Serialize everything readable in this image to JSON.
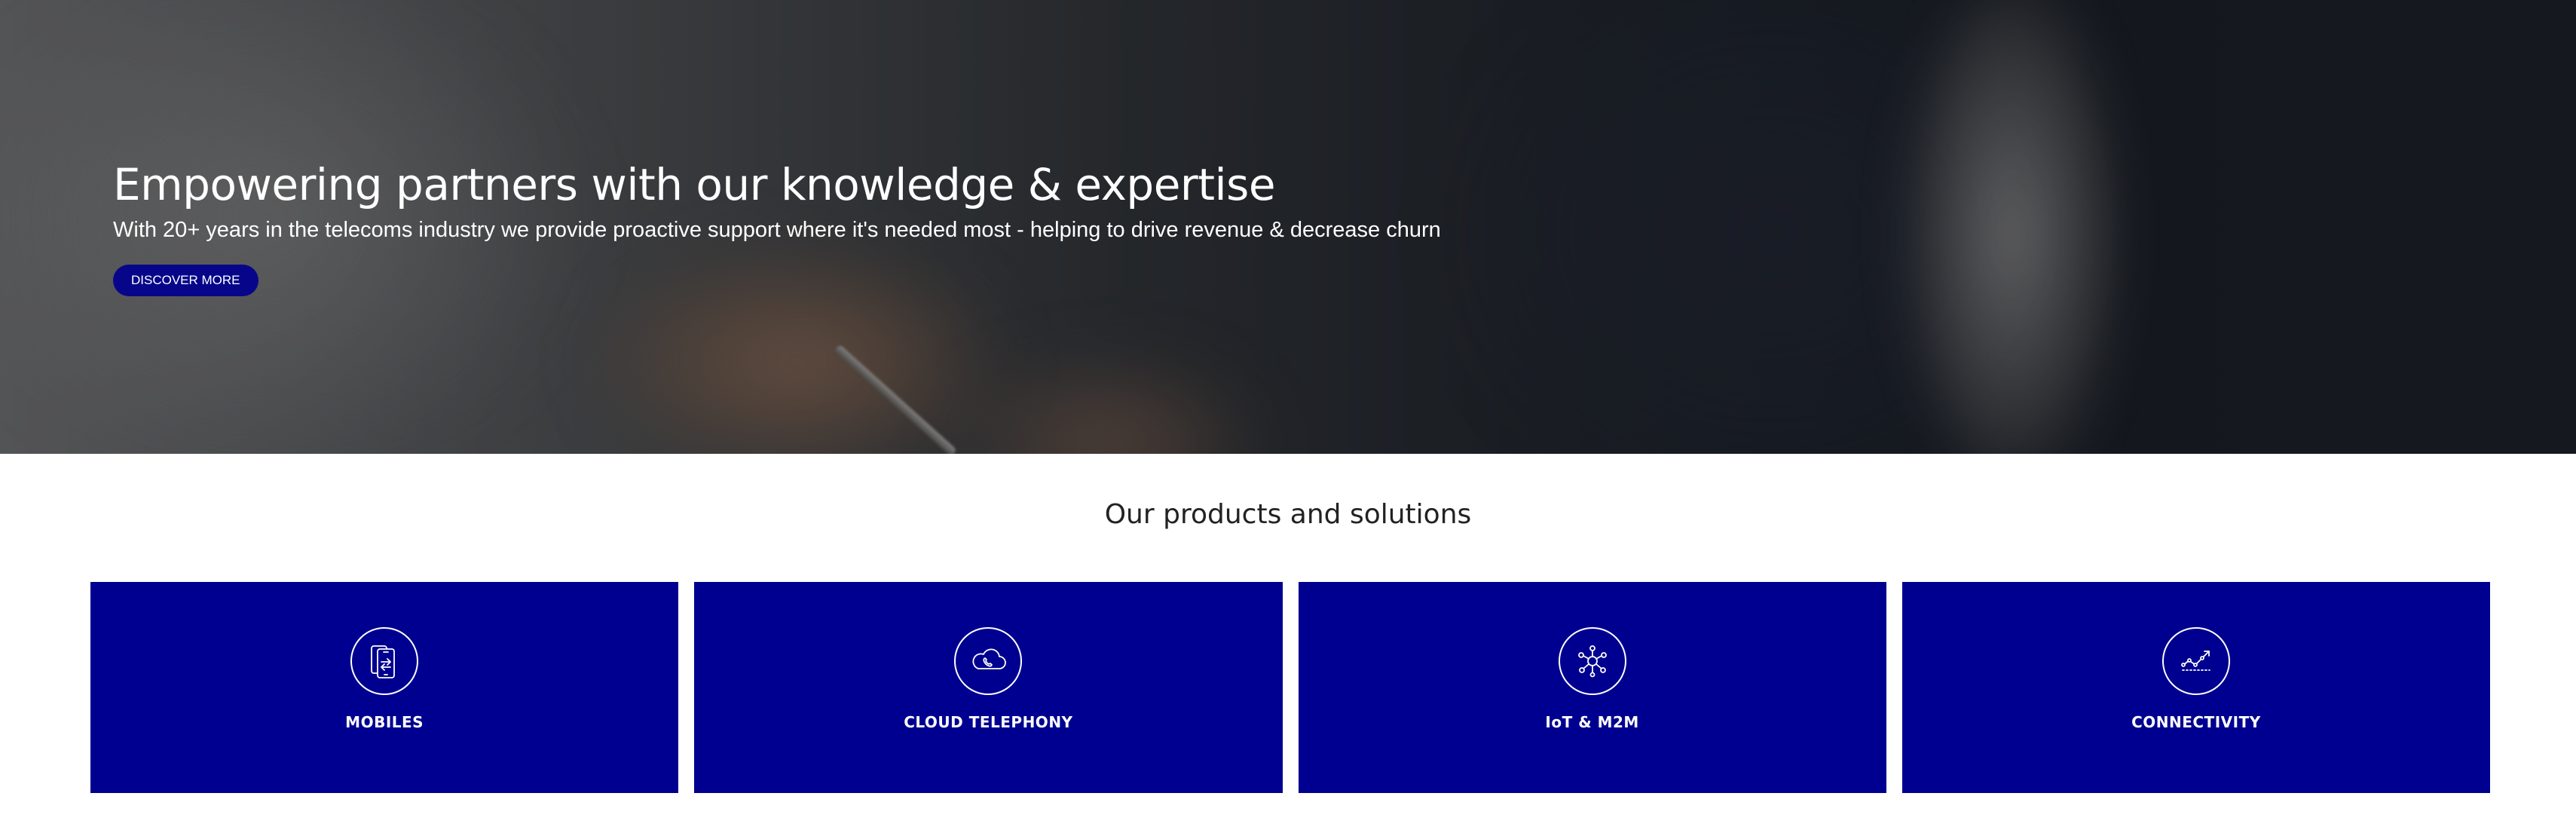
{
  "hero": {
    "title": "Empowering partners with our knowledge & expertise",
    "subtitle": "With 20+ years in the telecoms industry we provide proactive support where it's needed most - helping to drive revenue & decrease churn",
    "button_label": "DISCOVER MORE",
    "button_color": "#07068a"
  },
  "products": {
    "heading": "Our products and solutions",
    "card_color": "#000090",
    "items": [
      {
        "label": "MOBILES",
        "icon": "mobile-transfer-icon"
      },
      {
        "label": "CLOUD TELEPHONY",
        "icon": "cloud-phone-icon"
      },
      {
        "label": "IoT & M2M",
        "icon": "network-hub-icon"
      },
      {
        "label": "CONNECTIVITY",
        "icon": "connectivity-graph-icon"
      }
    ]
  }
}
